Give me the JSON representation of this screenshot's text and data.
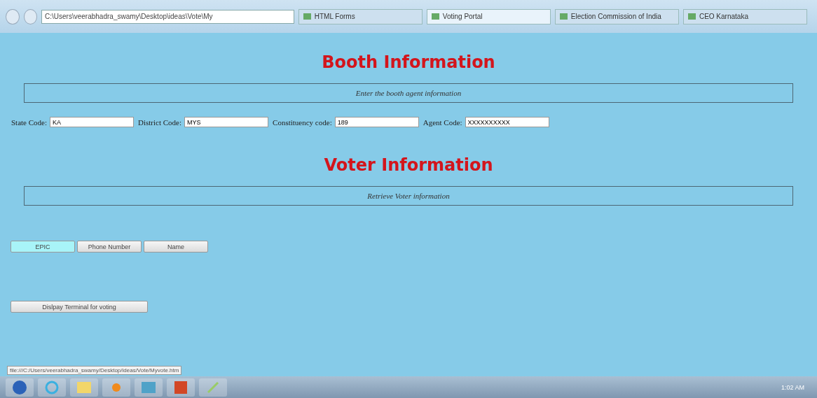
{
  "browser": {
    "address": "C:\\Users\\veerabhadra_swamy\\Desktop\\ideas\\Vote\\My ",
    "tabs": [
      {
        "label": "HTML Forms",
        "selected": false
      },
      {
        "label": "Voting Portal",
        "selected": true
      },
      {
        "label": "Election Commission of India",
        "selected": false
      },
      {
        "label": "CEO Karnataka",
        "selected": false
      }
    ]
  },
  "booth": {
    "title": "Booth Information",
    "note": "Enter the booth agent information",
    "fields": [
      {
        "label": "State Code:",
        "value": "KA"
      },
      {
        "label": "District Code:",
        "value": "MYS"
      },
      {
        "label": "Constituency code:",
        "value": "189"
      },
      {
        "label": "Agent Code:",
        "value": "XXXXXXXXXX"
      }
    ]
  },
  "voter": {
    "title": "Voter Information",
    "note": "Retrieve Voter information",
    "search_buttons": [
      {
        "label": "EPIC",
        "selected": true
      },
      {
        "label": "Phone Number",
        "selected": false
      },
      {
        "label": "Name",
        "selected": false
      }
    ],
    "action_button": "Dislpay Terminal for voting"
  },
  "status_url": "file:///C:/Users/veerabhadra_swamy/Desktop/ideas/Vote/Myvote.htm",
  "taskbar": {
    "clock": "1:02 AM"
  }
}
